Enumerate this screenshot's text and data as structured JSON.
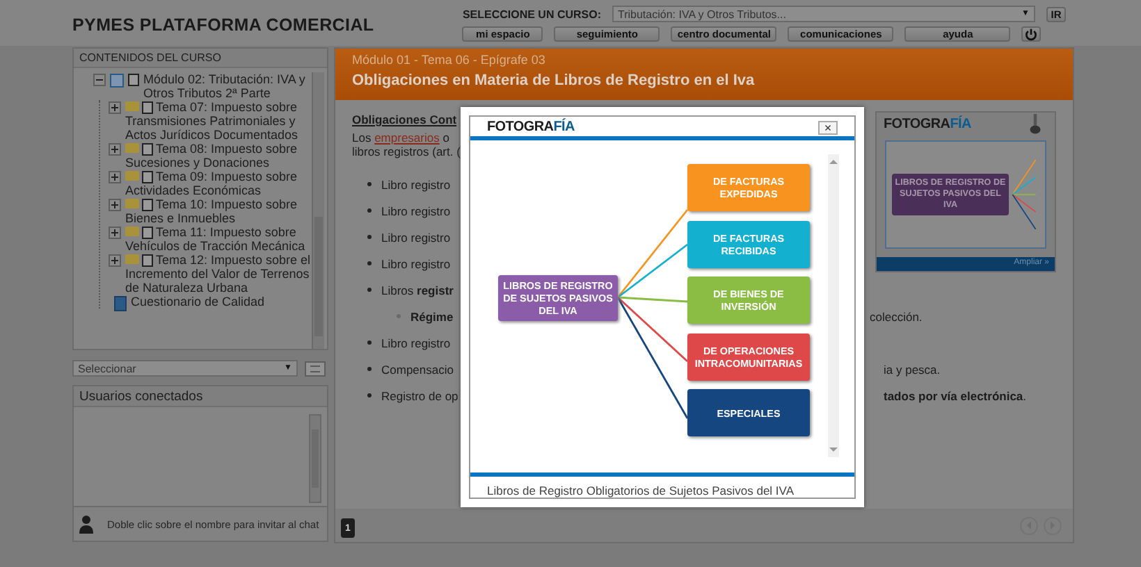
{
  "header": {
    "title": "PYMES PLATAFORMA COMERCIAL",
    "course_label": "SELECCIONE UN CURSO:",
    "course_select": {
      "value": "Tributación: IVA y Otros Tributos...",
      "arrow": "▼"
    },
    "go_button": "IR",
    "nav_buttons": [
      "mi espacio",
      "seguimiento",
      "centro documental",
      "comunicaciones",
      "ayuda"
    ]
  },
  "sidebar": {
    "contents_title": "CONTENIDOS DEL CURSO",
    "tree": [
      {
        "kind": "module",
        "label": "Módulo 02: Tributación: IVA y Otros Tributos 2ª Parte",
        "expanded": true,
        "children": [
          {
            "kind": "topic",
            "label": "Tema 07: Impuesto sobre Transmisiones Patrimoniales y Actos Jurídicos Documentados",
            "expanded": false
          },
          {
            "kind": "topic",
            "label": "Tema 08: Impuesto sobre Sucesiones y Donaciones",
            "expanded": false
          },
          {
            "kind": "topic",
            "label": "Tema 09: Impuesto sobre Actividades Económicas",
            "expanded": false
          },
          {
            "kind": "topic",
            "label": "Tema 10: Impuesto sobre Bienes e Inmuebles",
            "expanded": false
          },
          {
            "kind": "topic",
            "label": "Tema 11: Impuesto sobre Vehículos de Tracción Mecánica",
            "expanded": false
          },
          {
            "kind": "topic",
            "label": "Tema 12: Impuesto sobre el Incremento del Valor de Terrenos de Naturaleza Urbana",
            "expanded": false
          },
          {
            "kind": "quiz",
            "label": "Cuestionario de Calidad"
          }
        ]
      }
    ],
    "section_select": {
      "value": "Seleccionar",
      "arrow": "▼"
    },
    "users_title": "Usuarios conectados",
    "chat_hint": "Doble clic sobre el nombre para invitar al chat"
  },
  "lesson": {
    "breadcrumb": "Módulo 01 - Tema 06 - Epígrafe 03",
    "title": "Obligaciones en Materia de Libros de Registro en el Iva",
    "lines": [
      {
        "kind": "heading",
        "parts": [
          {
            "text": "Obligaciones Cont"
          }
        ]
      },
      {
        "kind": "text",
        "parts": [
          {
            "text": "Los "
          },
          {
            "text": "empresarios",
            "link": true
          },
          {
            "text": " o"
          }
        ]
      },
      {
        "kind": "text",
        "parts": [
          {
            "text": "libros registros (art. ("
          }
        ]
      },
      {
        "kind": "bullet",
        "parts": [
          {
            "text": "Libro registro"
          }
        ]
      },
      {
        "kind": "bullet",
        "parts": [
          {
            "text": "Libro registro"
          }
        ]
      },
      {
        "kind": "bullet",
        "parts": [
          {
            "text": "Libro registro"
          }
        ]
      },
      {
        "kind": "bullet",
        "parts": [
          {
            "text": "Libro registro"
          }
        ]
      },
      {
        "kind": "bullet",
        "parts": [
          {
            "text": "Libros **registr**"
          }
        ]
      },
      {
        "kind": "subbullet",
        "parts": [
          {
            "text": "**Régime**"
          }
        ],
        "right": "colección."
      },
      {
        "kind": "bullet",
        "parts": [
          {
            "text": "Libro registro"
          }
        ]
      },
      {
        "kind": "bullet",
        "parts": [
          {
            "text": "Compensacio"
          }
        ],
        "right": "ia y pesca."
      },
      {
        "kind": "bullet",
        "parts": [
          {
            "text": "Registro de op"
          }
        ],
        "right": "**tados por vía electrónica**."
      }
    ],
    "thumbnail": {
      "logo": {
        "text": "FOTOGRA",
        "accent": "FÍA"
      },
      "image_label": "LIBROS DE REGISTRO DE SUJETOS PASIVOS DEL IVA",
      "enlarge": "Ampliar »"
    },
    "pager": [
      {
        "label": "1",
        "selected": true
      }
    ]
  },
  "modal": {
    "logo": {
      "text": "FOTOGRA",
      "accent": "FÍA"
    },
    "close": "×",
    "diagram": {
      "root": {
        "label": "LIBROS DE REGISTRO DE SUJETOS PASIVOS DEL IVA",
        "color": "#8b5ca8"
      },
      "branches": [
        {
          "label": "DE FACTURAS EXPEDIDAS",
          "color": "#f7931e"
        },
        {
          "label": "DE FACTURAS RECIBIDAS",
          "color": "#13b0cf"
        },
        {
          "label": "DE BIENES DE INVERSIÓN",
          "color": "#8bbd45"
        },
        {
          "label": "DE OPERACIONES INTRACOMUNITARIAS",
          "color": "#df4848"
        },
        {
          "label": "ESPECIALES",
          "color": "#15467f"
        }
      ]
    },
    "caption": "Libros de Registro Obligatorios de Sujetos Pasivos del IVA"
  }
}
